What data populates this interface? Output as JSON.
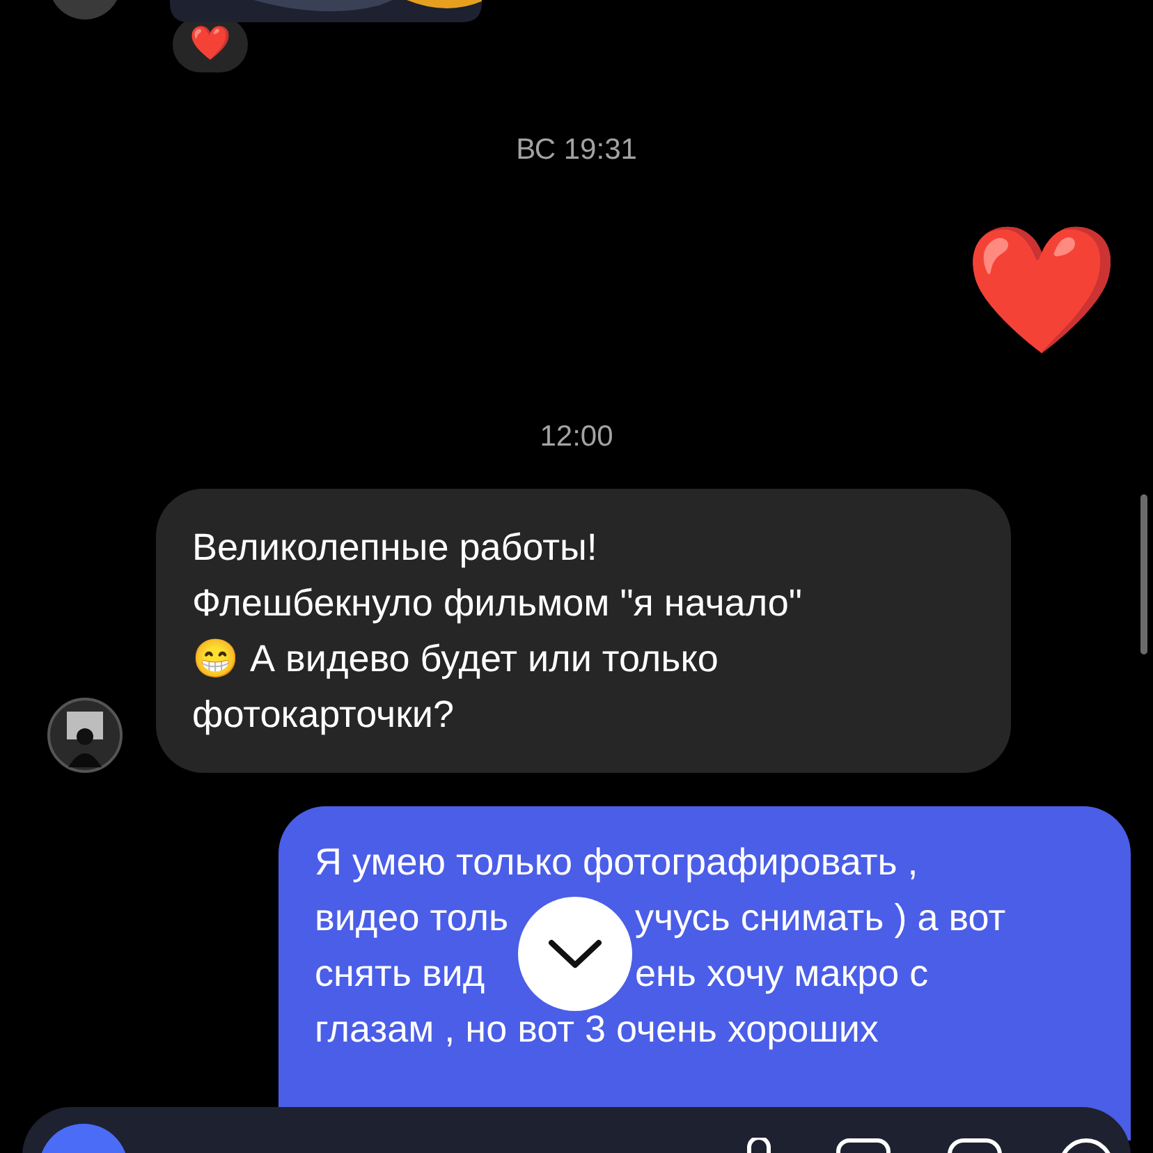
{
  "reaction": {
    "emoji": "❤️"
  },
  "messages": [
    {
      "kind": "time",
      "text": "ВС 19:31"
    },
    {
      "kind": "sent-emoji",
      "text": "❤️"
    },
    {
      "kind": "time",
      "text": "12:00"
    },
    {
      "kind": "received",
      "lines": [
        "Великолепные работы!",
        "Флешбекнуло фильмом \"я начало\"",
        "😁  А видево будет или только",
        "фотокарточки?"
      ]
    },
    {
      "kind": "sent",
      "lines": [
        [
          "Я умею только фотографировать ,"
        ],
        [
          "видео толь",
          "учусь снимать ) а вот"
        ],
        [
          "снять вид",
          "ень хочу макро с"
        ],
        [
          "глазам , но вот 3 очень хороших"
        ]
      ]
    }
  ]
}
